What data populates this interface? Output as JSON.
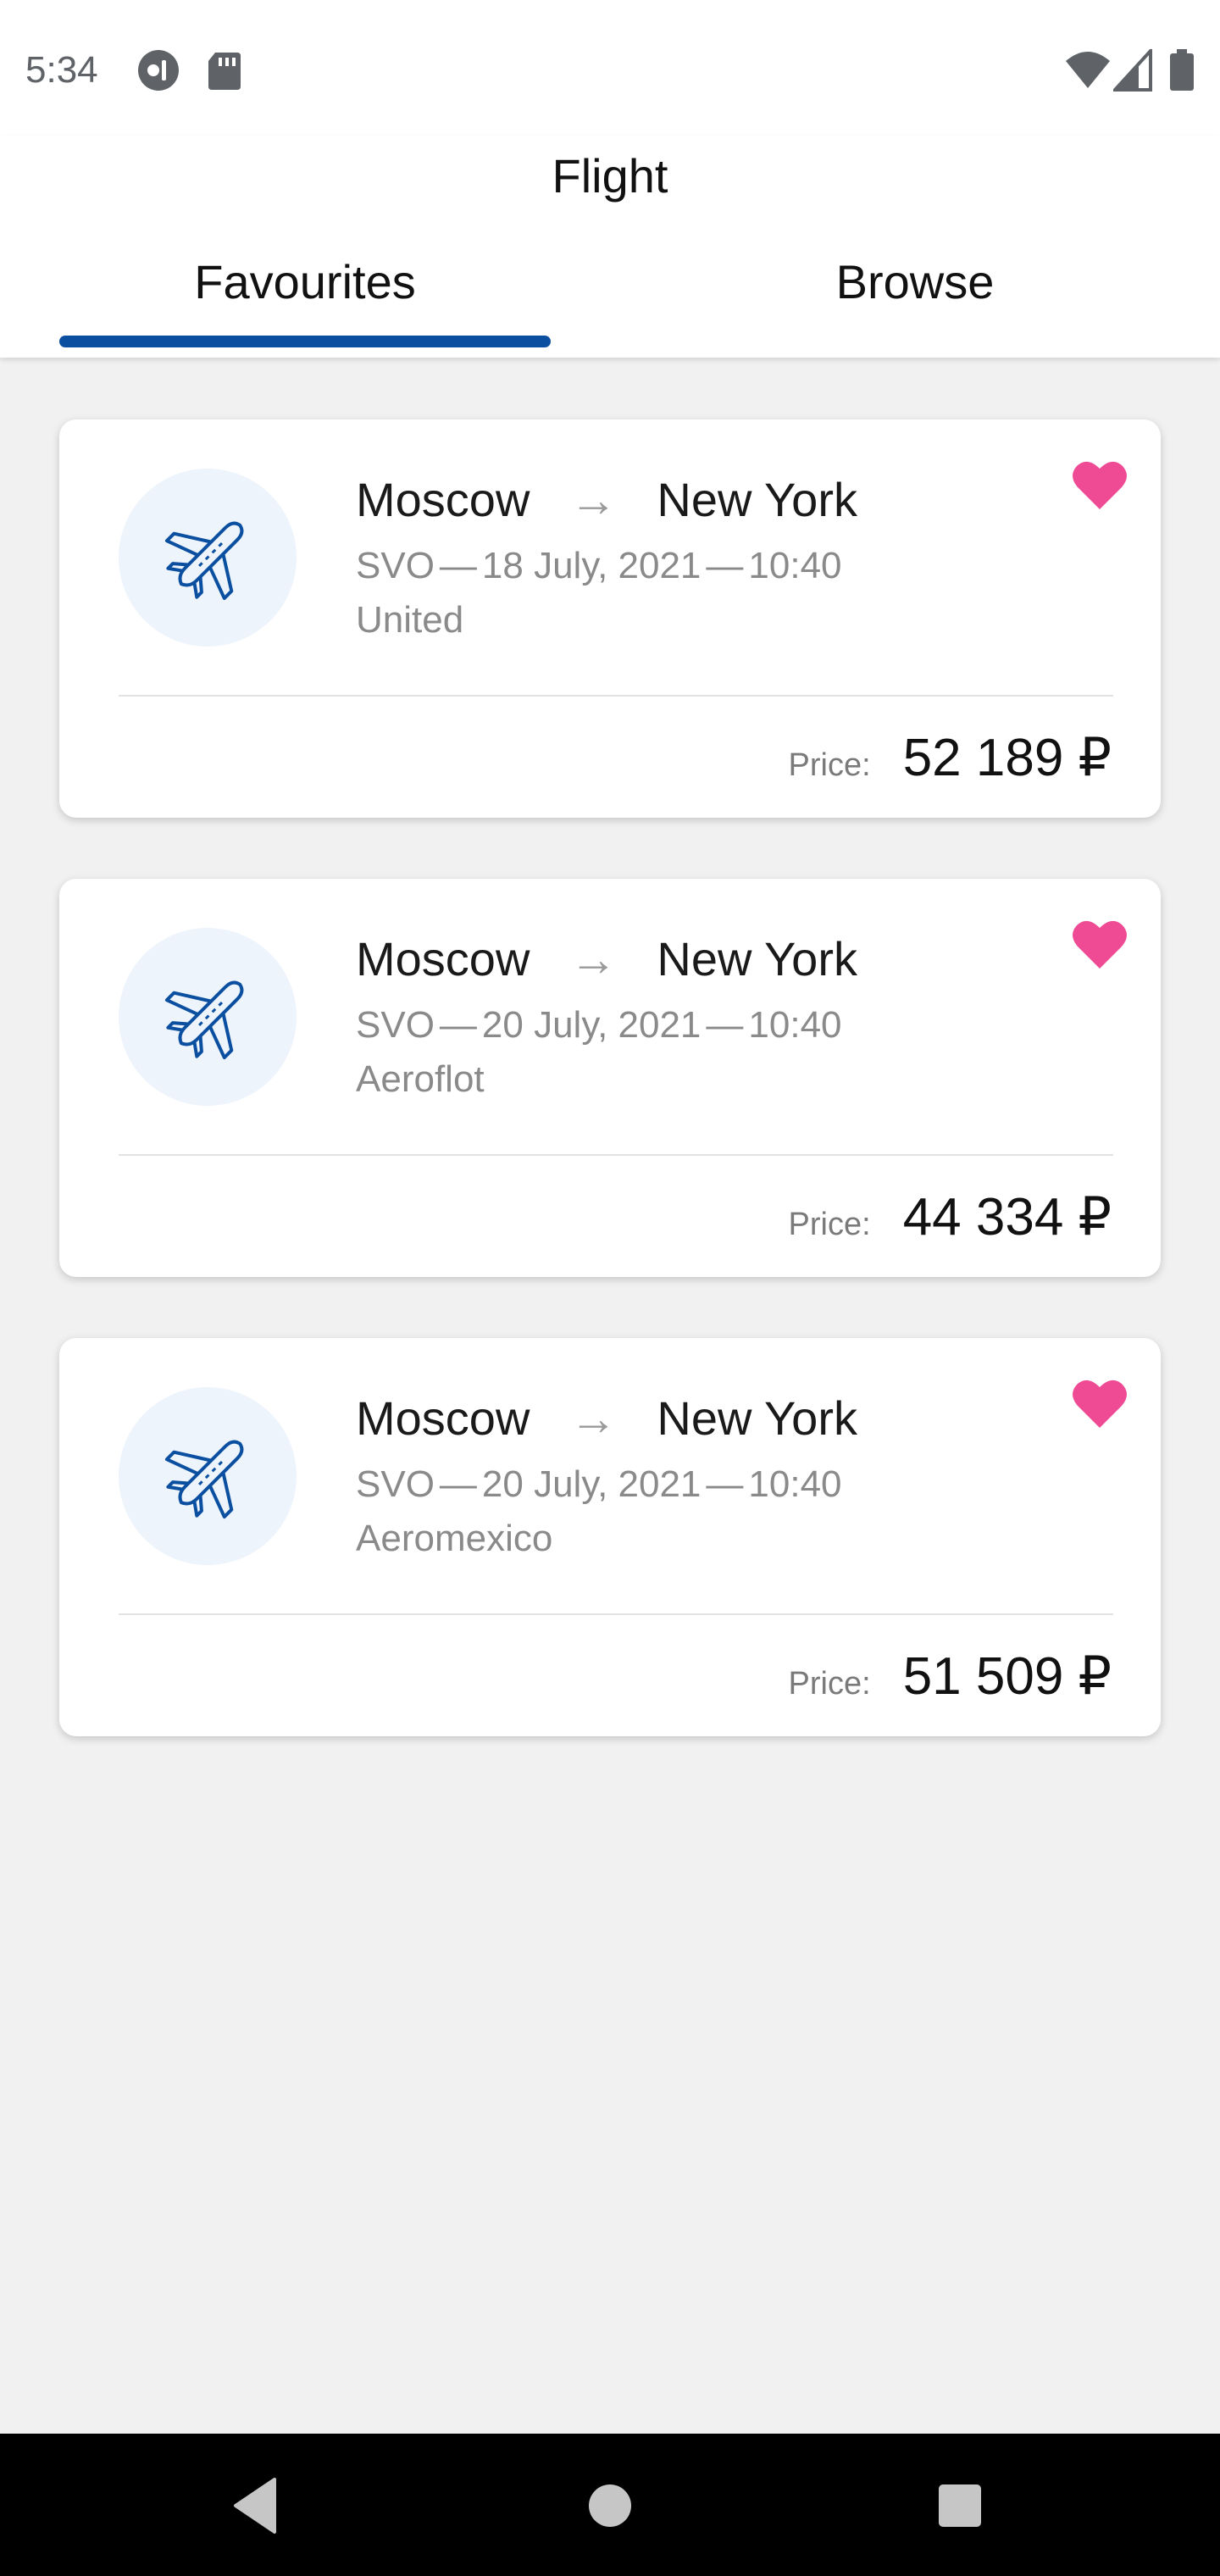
{
  "status_bar": {
    "time": "5:34",
    "left_icons": [
      "lastpass-icon",
      "sd-card-icon"
    ],
    "right_icons": [
      "wifi-icon",
      "signal-icon",
      "battery-icon"
    ]
  },
  "header": {
    "title": "Flight",
    "tabs": [
      {
        "label": "Favourites",
        "selected": true
      },
      {
        "label": "Browse",
        "selected": false
      }
    ]
  },
  "colors": {
    "accent": "#0b4fa0",
    "heart": "#ef4b95",
    "background": "#f1f1f1"
  },
  "flights": [
    {
      "from": "Moscow",
      "to": "New York",
      "route_arrow": "→",
      "code": "SVO",
      "sep": "—",
      "date": "18 July, 2021",
      "time": "10:40",
      "airline": "United",
      "price_label": "Price:",
      "price": "52 189 ₽",
      "favourite": true
    },
    {
      "from": "Moscow",
      "to": "New York",
      "route_arrow": "→",
      "code": "SVO",
      "sep": "—",
      "date": "20 July, 2021",
      "time": "10:40",
      "airline": "Aeroflot",
      "price_label": "Price:",
      "price": "44 334 ₽",
      "favourite": true
    },
    {
      "from": "Moscow",
      "to": "New York",
      "route_arrow": "→",
      "code": "SVO",
      "sep": "—",
      "date": "20 July, 2021",
      "time": "10:40",
      "airline": "Aeromexico",
      "price_label": "Price:",
      "price": "51 509 ₽",
      "favourite": true
    }
  ],
  "nav_bar": {
    "icons": [
      "back-icon",
      "home-icon",
      "recents-icon"
    ]
  }
}
